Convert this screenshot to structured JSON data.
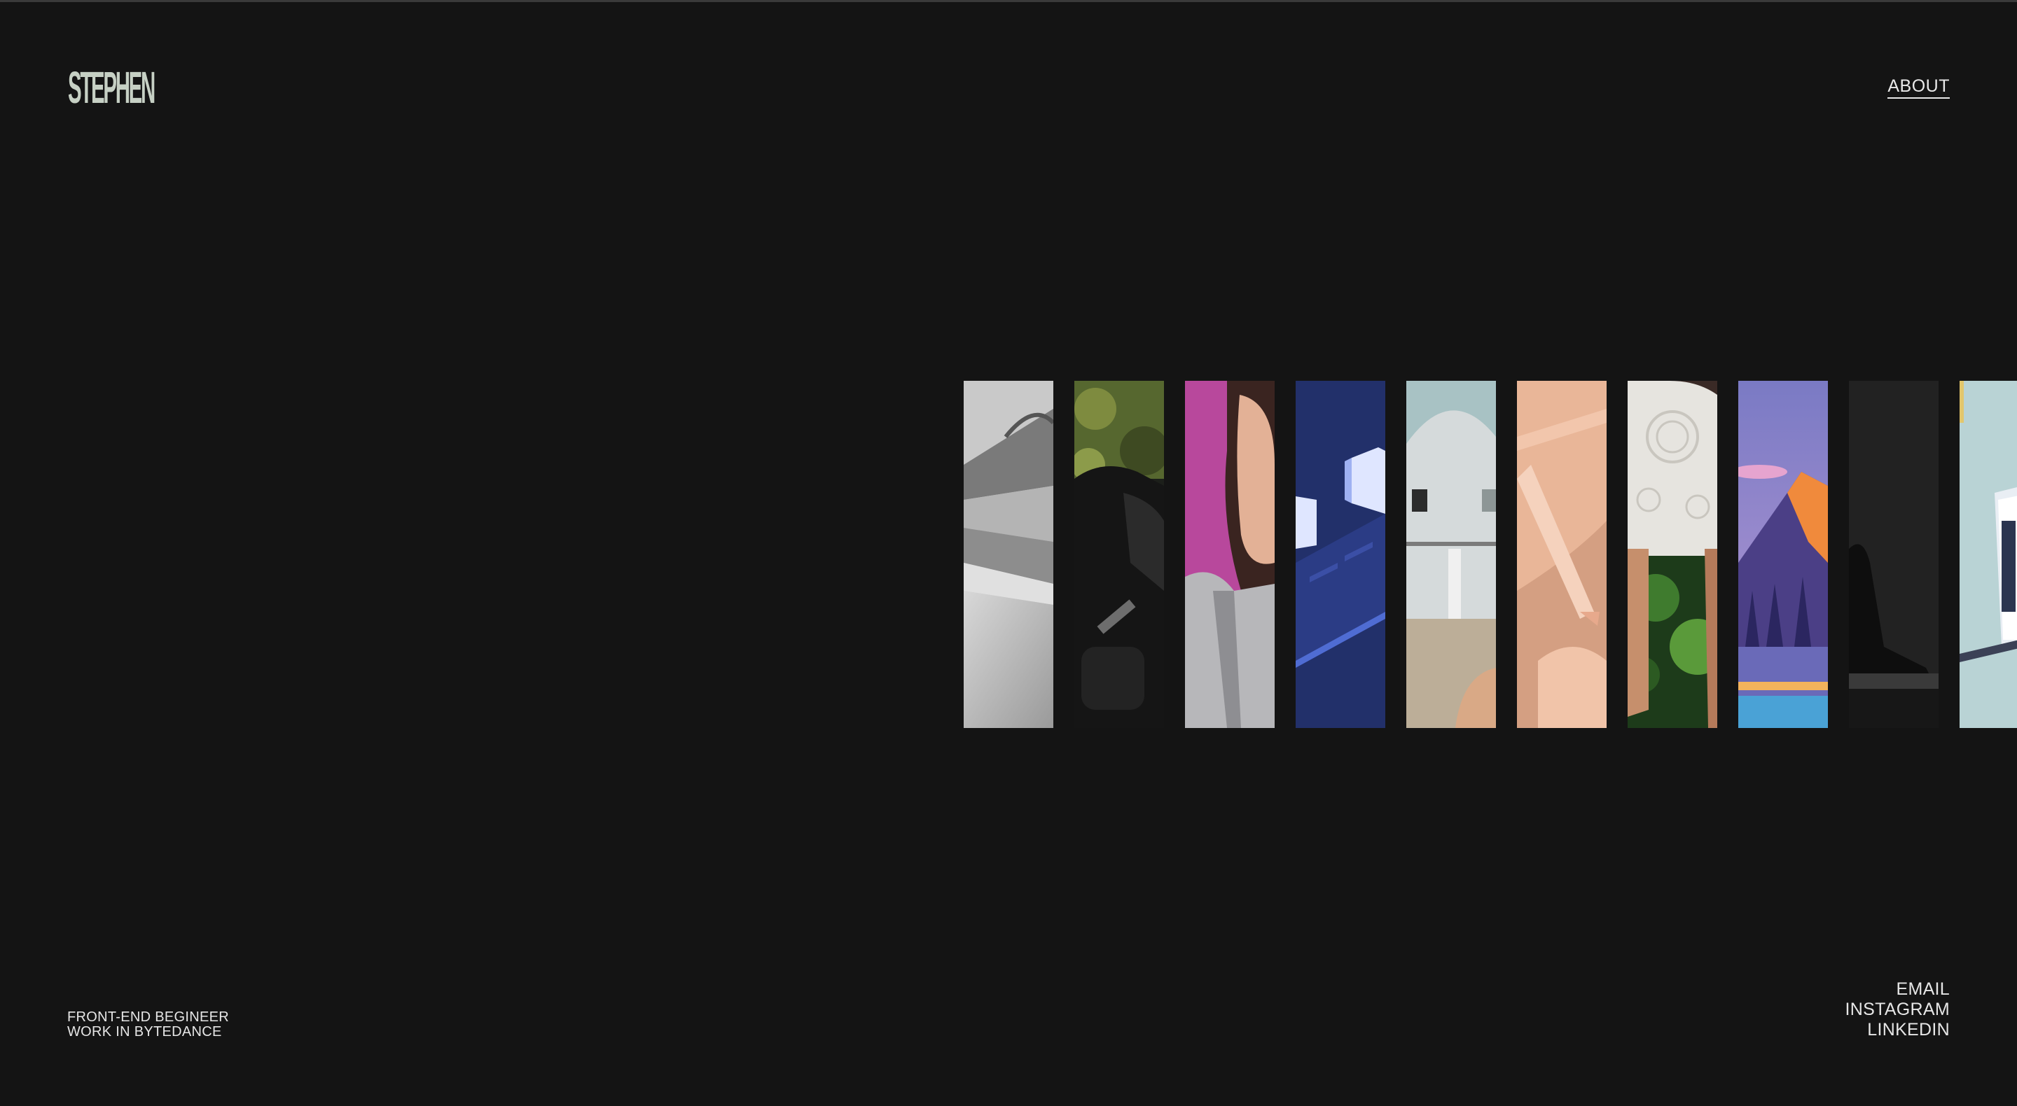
{
  "header": {
    "logo_text": "STEPHEN",
    "nav_about": "ABOUT"
  },
  "gallery": {
    "tiles": [
      {
        "name": "gallery-tile-paper-folds",
        "description_icon": "abstract-gray-folds"
      },
      {
        "name": "gallery-tile-person-backpack",
        "description_icon": "person-forest"
      },
      {
        "name": "gallery-tile-woman-portrait",
        "description_icon": "portrait-magenta"
      },
      {
        "name": "gallery-tile-isometric-servers",
        "description_icon": "isometric-blue"
      },
      {
        "name": "gallery-tile-white-building",
        "description_icon": "architecture"
      },
      {
        "name": "gallery-tile-peach-product",
        "description_icon": "peach-object"
      },
      {
        "name": "gallery-tile-lace-dress",
        "description_icon": "lace-fashion"
      },
      {
        "name": "gallery-tile-mountain-illustration",
        "description_icon": "mountain-sunset"
      },
      {
        "name": "gallery-tile-dark-sculpture",
        "description_icon": "sculpture-dark"
      },
      {
        "name": "gallery-tile-phone-mockup",
        "description_icon": "phone-device"
      }
    ]
  },
  "footer": {
    "bio_line1": "FRONT-END BEGINEER",
    "bio_line2": "WORK IN BYTEDANCE",
    "links": {
      "email": "EMAIL",
      "instagram": "INSTAGRAM",
      "linkedin": "LINKEDIN"
    }
  },
  "colors": {
    "background": "#141414",
    "logo": "#c6d0c4",
    "text": "#e6e6e6"
  }
}
